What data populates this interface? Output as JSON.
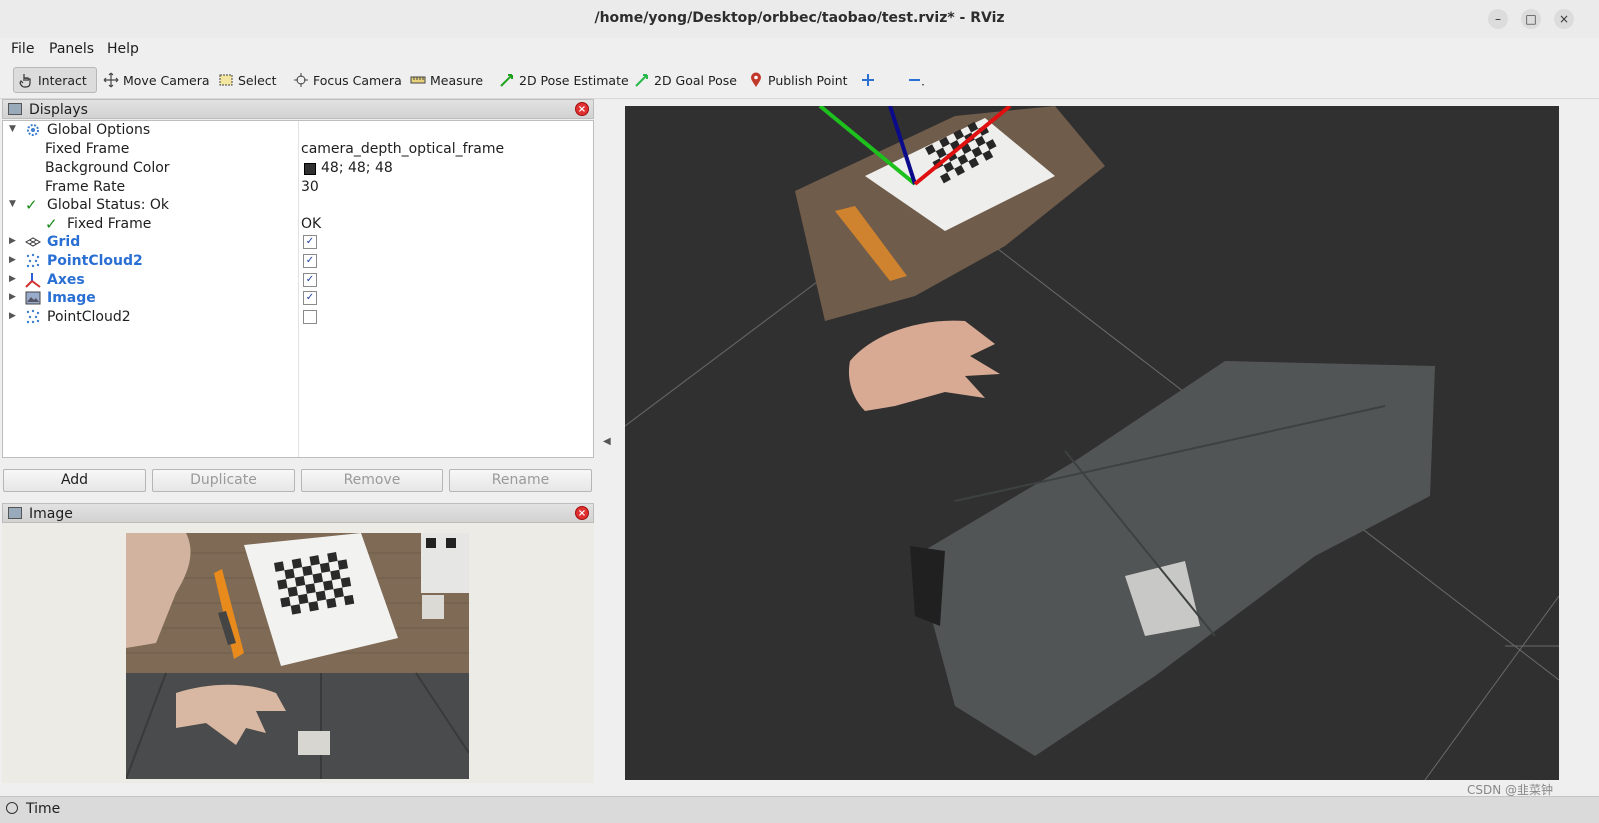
{
  "window": {
    "title": "/home/yong/Desktop/orbbec/taobao/test.rviz* - RViz",
    "minimize": "–",
    "maximize": "□",
    "close": "×"
  },
  "menu": {
    "file": "File",
    "panels": "Panels",
    "help": "Help"
  },
  "toolbar": {
    "interact": "Interact",
    "move_camera": "Move Camera",
    "select": "Select",
    "focus_camera": "Focus Camera",
    "measure": "Measure",
    "pose_estimate": "2D Pose Estimate",
    "goal_pose": "2D Goal Pose",
    "publish_point": "Publish Point"
  },
  "displays": {
    "title": "Displays",
    "global_options": "Global Options",
    "fixed_frame_label": "Fixed Frame",
    "fixed_frame_value": "camera_depth_optical_frame",
    "bg_color_label": "Background Color",
    "bg_color_value": "48; 48; 48",
    "bg_color_hex": "#303030",
    "frame_rate_label": "Frame Rate",
    "frame_rate_value": "30",
    "global_status": "Global Status: Ok",
    "status_fixed_frame_label": "Fixed Frame",
    "status_fixed_frame_value": "OK",
    "items": [
      {
        "label": "Grid",
        "checked": true
      },
      {
        "label": "PointCloud2",
        "checked": true
      },
      {
        "label": "Axes",
        "checked": true
      },
      {
        "label": "Image",
        "checked": true
      },
      {
        "label": "PointCloud2",
        "checked": false
      }
    ],
    "check_mark": "✓"
  },
  "buttons": {
    "add": "Add",
    "duplicate": "Duplicate",
    "remove": "Remove",
    "rename": "Rename"
  },
  "image_panel": {
    "title": "Image"
  },
  "time_panel": {
    "title": "Time"
  },
  "watermark": "CSDN @韭菜钟"
}
